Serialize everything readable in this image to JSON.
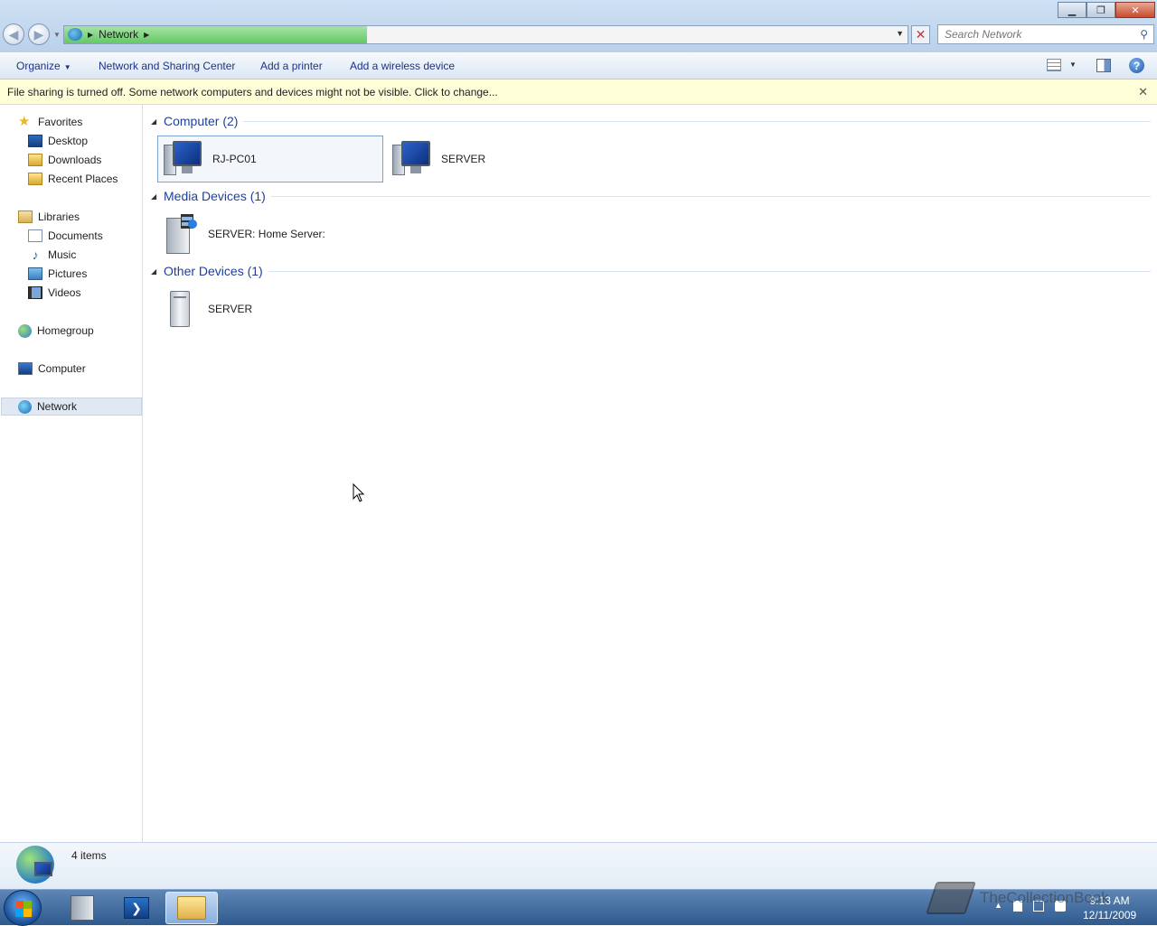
{
  "window": {
    "controls": {
      "minimize": "▁",
      "maximize": "❐",
      "close": "✕"
    }
  },
  "address_bar": {
    "location": "Network",
    "search_placeholder": "Search Network"
  },
  "command_bar": {
    "organize": "Organize",
    "network_sharing_center": "Network and Sharing Center",
    "add_printer": "Add a printer",
    "add_wireless": "Add a wireless device",
    "help_label": "?"
  },
  "infobar": {
    "message": "File sharing is turned off. Some network computers and devices might not be visible. Click to change...",
    "close": "✕"
  },
  "nav_pane": {
    "favorites": "Favorites",
    "desktop": "Desktop",
    "downloads": "Downloads",
    "recent_places": "Recent Places",
    "libraries": "Libraries",
    "documents": "Documents",
    "music": "Music",
    "pictures": "Pictures",
    "videos": "Videos",
    "homegroup": "Homegroup",
    "computer": "Computer",
    "network": "Network"
  },
  "groups": {
    "computer": {
      "title": "Computer (2)",
      "items": [
        "RJ-PC01",
        "SERVER"
      ]
    },
    "media": {
      "title": "Media Devices (1)",
      "items": [
        "SERVER: Home Server:"
      ]
    },
    "other": {
      "title": "Other Devices (1)",
      "items": [
        "SERVER"
      ]
    }
  },
  "details": {
    "count": "4 items"
  },
  "taskbar": {
    "clock_time": "9:13 AM",
    "clock_date": "12/11/2009",
    "powershell_glyph": "❯"
  },
  "watermark": "TheCollectionBook"
}
